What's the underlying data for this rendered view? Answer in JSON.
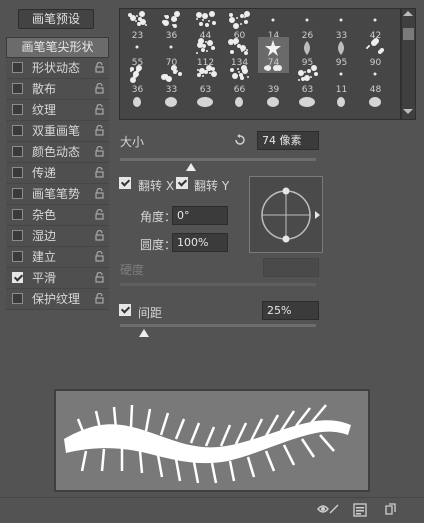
{
  "preset_button": "画笔预设",
  "left_panel": {
    "header": "画笔笔尖形状",
    "items": [
      {
        "label": "形状动态",
        "checked": false,
        "locked": true
      },
      {
        "label": "散布",
        "checked": false,
        "locked": true
      },
      {
        "label": "纹理",
        "checked": false,
        "locked": true
      },
      {
        "label": "双重画笔",
        "checked": false,
        "locked": true
      },
      {
        "label": "颜色动态",
        "checked": false,
        "locked": true
      },
      {
        "label": "传递",
        "checked": false,
        "locked": true
      },
      {
        "label": "画笔笔势",
        "checked": false,
        "locked": true
      },
      {
        "label": "杂色",
        "checked": false,
        "locked": true
      },
      {
        "label": "湿边",
        "checked": false,
        "locked": true
      },
      {
        "label": "建立",
        "checked": false,
        "locked": true
      },
      {
        "label": "平滑",
        "checked": true,
        "locked": true
      },
      {
        "label": "保护纹理",
        "checked": false,
        "locked": true
      }
    ]
  },
  "brush_tips": {
    "rows": [
      [
        "23",
        "36",
        "44",
        "60",
        "14",
        "26",
        "33",
        "42"
      ],
      [
        "55",
        "70",
        "112",
        "134",
        "74",
        "95",
        "95",
        "90"
      ],
      [
        "36",
        "33",
        "63",
        "66",
        "39",
        "63",
        "11",
        "48"
      ],
      [
        "",
        "",
        "",
        "",
        "",
        "",
        "",
        ""
      ]
    ],
    "selected": "74"
  },
  "size": {
    "label": "大小",
    "value": "74 像素"
  },
  "flip_x": {
    "label": "翻转 X",
    "checked": true
  },
  "flip_y": {
    "label": "翻转 Y",
    "checked": true
  },
  "angle": {
    "label": "角度：",
    "value": "0°"
  },
  "roundness": {
    "label": "圆度：",
    "value": "100%"
  },
  "hardness": {
    "label": "硬度"
  },
  "spacing": {
    "label": "间距",
    "value": "25%",
    "checked": true
  },
  "colors": {
    "panel": "#535353",
    "accent": "#eeeeee"
  }
}
